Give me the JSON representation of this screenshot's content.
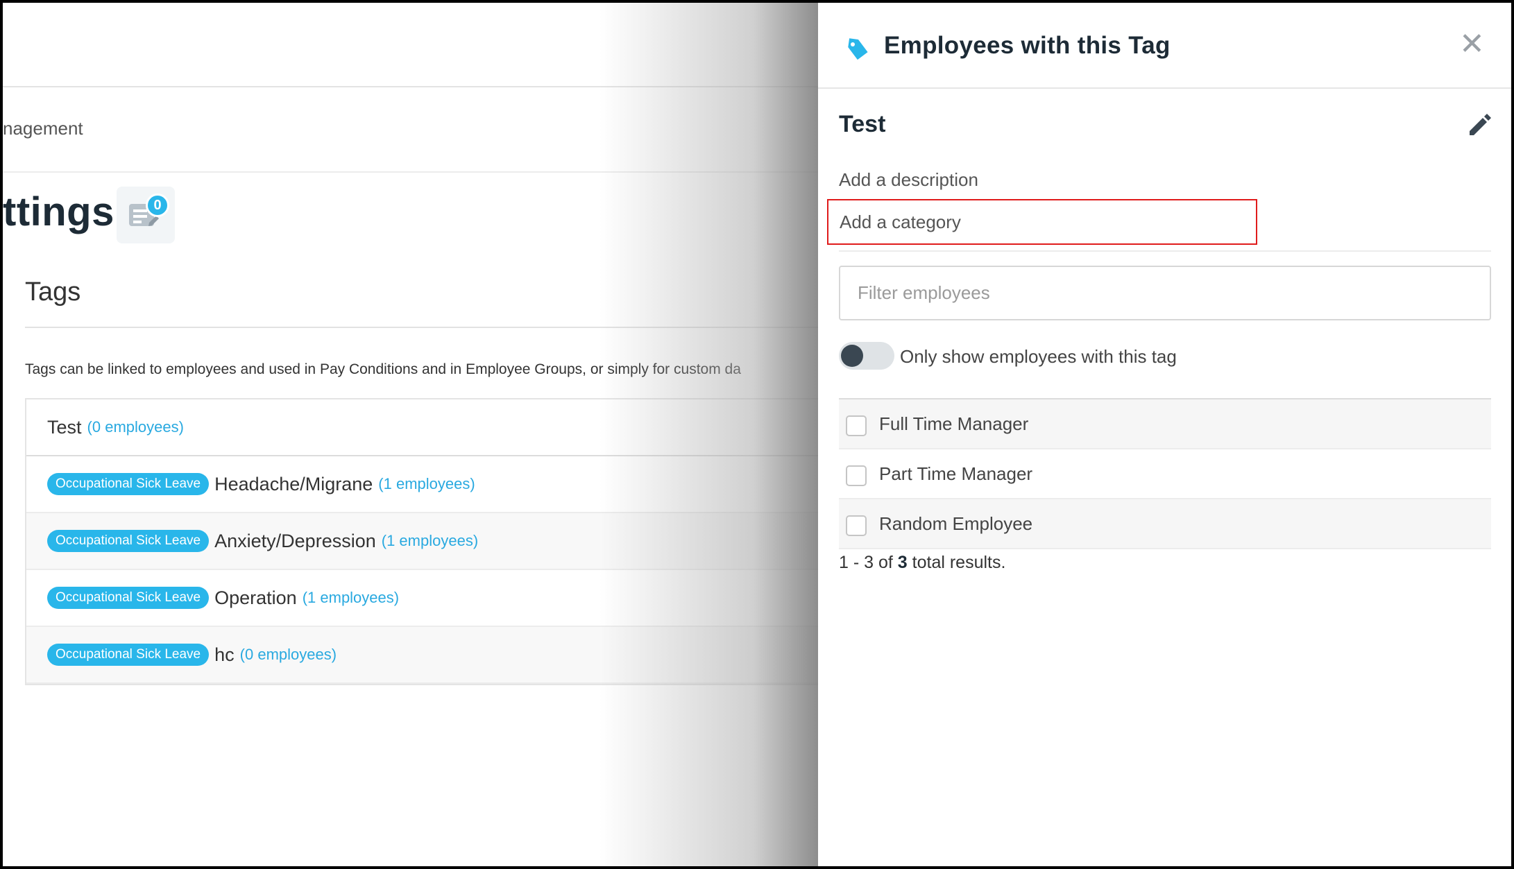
{
  "background": {
    "breadcrumb": "nagement",
    "page_title": "ttings",
    "notes_count": "0",
    "section_title": "Tags",
    "description": "Tags can be linked to employees and used in Pay Conditions and in Employee Groups, or simply for custom da",
    "tags": [
      {
        "category": "",
        "name": "Test",
        "count": "(0 employees)"
      },
      {
        "category": "Occupational Sick Leave",
        "name": "Headache/Migrane",
        "count": "(1 employees)"
      },
      {
        "category": "Occupational Sick Leave",
        "name": "Anxiety/Depression",
        "count": "(1 employees)"
      },
      {
        "category": "Occupational Sick Leave",
        "name": "Operation",
        "count": "(1 employees)"
      },
      {
        "category": "Occupational Sick Leave",
        "name": "hc",
        "count": "(0 employees)"
      }
    ]
  },
  "panel": {
    "title": "Employees with this Tag",
    "close_label": "✕",
    "tag_name": "Test",
    "description_placeholder": "Add a description",
    "category_placeholder": "Add a category",
    "filter_placeholder": "Filter employees",
    "toggle_label": "Only show employees with this tag",
    "employees": [
      {
        "name": "Full Time Manager"
      },
      {
        "name": "Part Time Manager"
      },
      {
        "name": "Random Employee"
      }
    ],
    "results": {
      "start": "1",
      "end": "3",
      "total": "3",
      "label_of": "of",
      "label_total": "total results."
    }
  },
  "colors": {
    "accent": "#29b6ea",
    "highlight_border": "#e01b1b",
    "title_text": "#1d2b36"
  }
}
